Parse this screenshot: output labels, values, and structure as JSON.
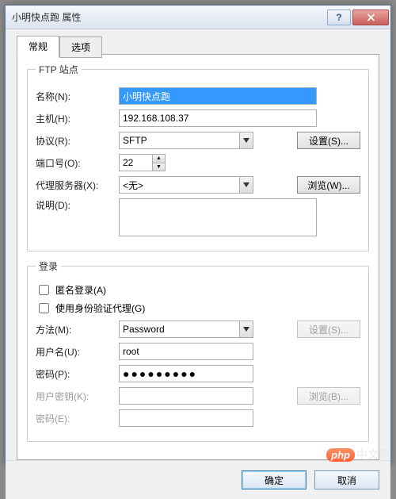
{
  "window": {
    "title": "小明快点跑 属性"
  },
  "tabs": {
    "general": "常规",
    "options": "选项"
  },
  "ftp": {
    "legend": "FTP 站点",
    "name_label": "名称(N):",
    "name_value": "小明快点跑",
    "host_label": "主机(H):",
    "host_value": "192.168.108.37",
    "protocol_label": "协议(R):",
    "protocol_value": "SFTP",
    "settings_btn": "设置(S)...",
    "port_label": "端口号(O):",
    "port_value": "22",
    "proxy_label": "代理服务器(X):",
    "proxy_value": "<无>",
    "browse_btn": "浏览(W)...",
    "desc_label": "说明(D):",
    "desc_value": ""
  },
  "login": {
    "legend": "登录",
    "anon_label": "匿名登录(A)",
    "useauth_label": "使用身份验证代理(G)",
    "method_label": "方法(M):",
    "method_value": "Password",
    "settings_btn": "设置(S)...",
    "user_label": "用户名(U):",
    "user_value": "root",
    "pass_label": "密码(P):",
    "pass_value": "●●●●●●●●●",
    "userkey_label": "用户密钥(K):",
    "browse_btn": "浏览(B)...",
    "passcode_label": "密码(E):"
  },
  "footer": {
    "ok": "确定",
    "cancel": "取消"
  },
  "watermark": {
    "badge": "php",
    "text": "中文网"
  }
}
